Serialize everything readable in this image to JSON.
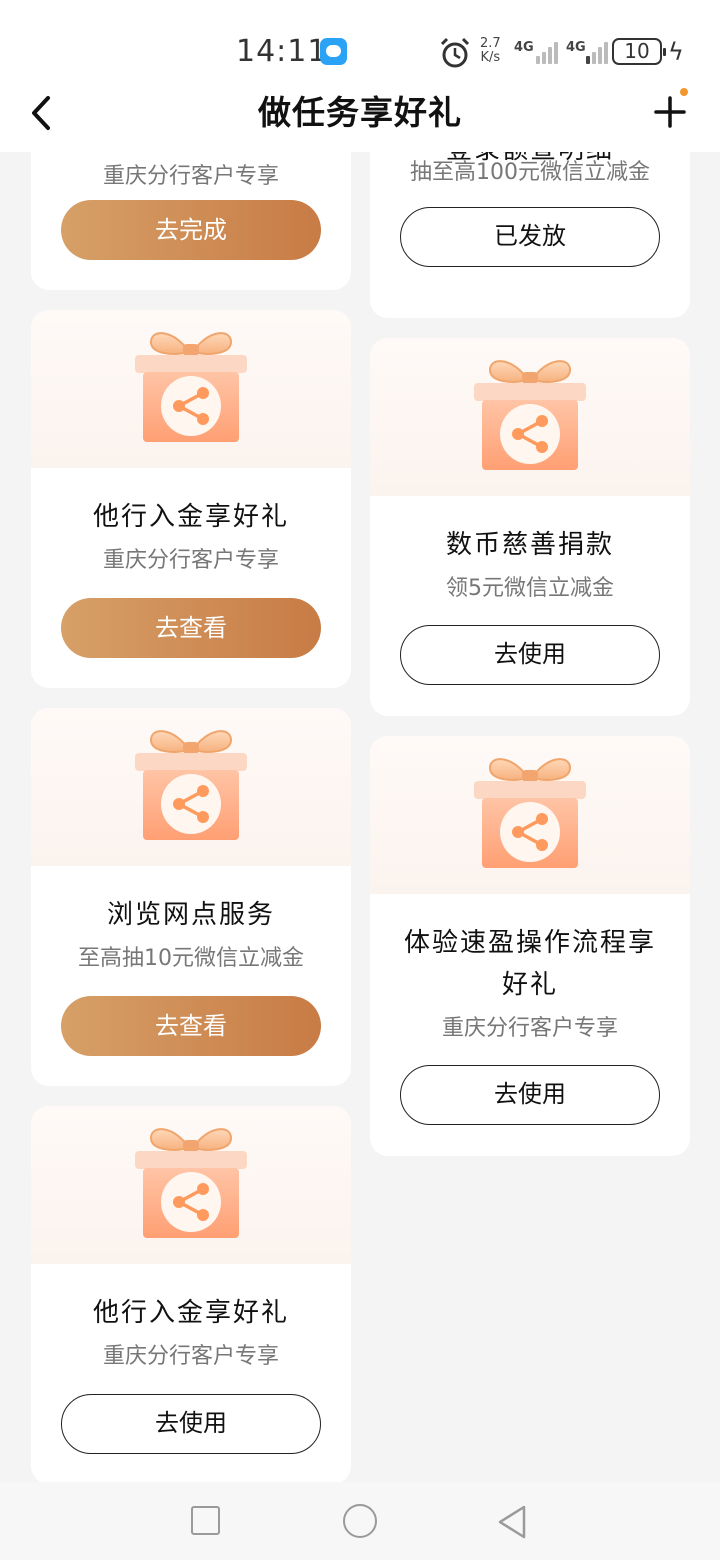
{
  "status_bar": {
    "time": "14:11",
    "speed_value": "2.7",
    "speed_unit": "K/s",
    "net1": "4G",
    "net2": "4G",
    "battery": "10"
  },
  "header": {
    "title": "做任务享好礼",
    "back_icon": "chevron-left-icon",
    "plus_icon": "plus-icon",
    "accent": "#f2972e"
  },
  "cards_left": [
    {
      "title": "",
      "subtitle": "重庆分行客户专享",
      "button": "去完成",
      "button_style": "filled"
    },
    {
      "title": "他行入金享好礼",
      "subtitle": "重庆分行客户专享",
      "button": "去查看",
      "button_style": "filled"
    },
    {
      "title": "浏览网点服务",
      "subtitle": "至高抽10元微信立减金",
      "button": "去查看",
      "button_style": "filled"
    },
    {
      "title": "他行入金享好礼",
      "subtitle": "重庆分行客户专享",
      "button": "去使用",
      "button_style": "outline"
    }
  ],
  "cards_right": [
    {
      "title": "登录额查明细",
      "subtitle": "抽至高100元微信立减金",
      "button": "已发放",
      "button_style": "outline"
    },
    {
      "title": "数币慈善捐款",
      "subtitle": "领5元微信立减金",
      "button": "去使用",
      "button_style": "outline"
    },
    {
      "title": "体验速盈操作流程享好礼",
      "subtitle": "重庆分行客户专享",
      "button": "去使用",
      "button_style": "outline"
    }
  ],
  "colors": {
    "button_gradient_start": "#d6a067",
    "button_gradient_end": "#c87b45",
    "gift_body": "#ffb08c",
    "page_bg": "#f4f4f4"
  },
  "nav_bar": {
    "recent_icon": "square-icon",
    "home_icon": "circle-icon",
    "back_icon": "triangle-back-icon"
  }
}
